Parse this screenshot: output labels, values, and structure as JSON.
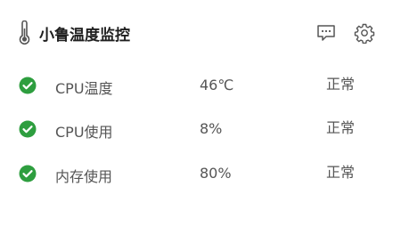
{
  "header": {
    "title": "小鲁温度监控",
    "icons": {
      "title": "thermometer-icon",
      "feedback": "message-icon",
      "settings": "gear-icon"
    }
  },
  "metrics": [
    {
      "label": "CPU温度",
      "value": "46℃",
      "status": "正常"
    },
    {
      "label": "CPU使用",
      "value": "8%",
      "status": "正常"
    },
    {
      "label": "内存使用",
      "value": "80%",
      "status": "正常"
    }
  ],
  "colors": {
    "status_ok": "#2e9e3f",
    "title_text": "#1f1f1f",
    "body_text": "#555555",
    "icon_stroke": "#555555"
  }
}
